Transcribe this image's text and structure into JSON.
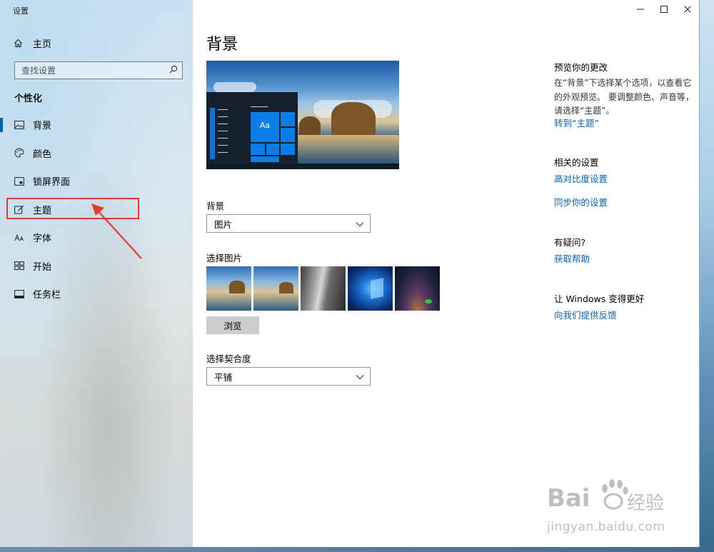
{
  "window": {
    "title": "设置",
    "controls": {
      "minimize": "minimize-icon",
      "maximize": "maximize-icon",
      "close": "close-icon"
    }
  },
  "sidebar": {
    "home_label": "主页",
    "search_placeholder": "查找设置",
    "section_label": "个性化",
    "items": [
      {
        "label": "背景",
        "icon": "picture-icon",
        "active": true
      },
      {
        "label": "颜色",
        "icon": "palette-icon"
      },
      {
        "label": "锁屏界面",
        "icon": "lock-screen-icon"
      },
      {
        "label": "主题",
        "icon": "theme-brush-icon",
        "highlighted": true
      },
      {
        "label": "字体",
        "icon": "font-icon"
      },
      {
        "label": "开始",
        "icon": "start-grid-icon"
      },
      {
        "label": "任务栏",
        "icon": "taskbar-icon"
      }
    ]
  },
  "main": {
    "page_title": "背景",
    "preview_tile_label": "Aa",
    "background_label": "背景",
    "background_value": "图片",
    "choose_picture_label": "选择图片",
    "browse_label": "浏览",
    "fit_label": "选择契合度",
    "fit_value": "平铺"
  },
  "right_panel": {
    "preview_heading": "预览你的更改",
    "preview_text": "在“背景”下选择某个选项，以查看它的外观预览。 要调整颜色、声音等，请选择“主题”。",
    "goto_themes_link": "转到“主题”",
    "related_heading": "相关的设置",
    "high_contrast_link": "高对比度设置",
    "sync_link": "同步你的设置",
    "question_heading": "有疑问?",
    "help_link": "获取帮助",
    "improve_heading": "让 Windows 变得更好",
    "feedback_link": "向我们提供反馈"
  },
  "watermark": {
    "brand": "Bai",
    "brand_suffix": "经验",
    "url": "jingyan.baidu.com"
  },
  "colors": {
    "accent": "#0063b1",
    "link": "#0a63b3",
    "highlight_border": "#e23b3b"
  }
}
